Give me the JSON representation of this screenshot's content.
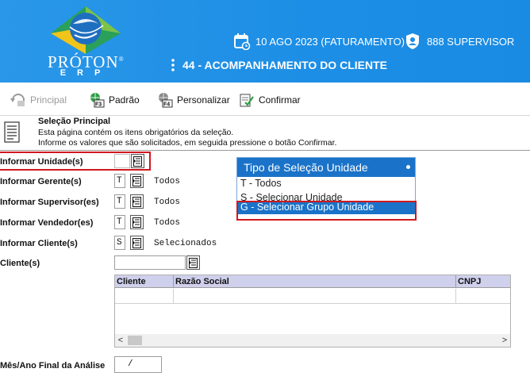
{
  "header": {
    "logo_name": "PRÓTON",
    "logo_sub": "ERP",
    "logo_mark": "®",
    "date_text": "10 AGO 2023 (FATURAMENTO)",
    "user_text": "888 SUPERVISOR",
    "screen_title": "44 - ACOMPANHAMENTO DO CLIENTE",
    "brand_color": "#1c8ee5"
  },
  "toolbar": {
    "principal_label": "Principal",
    "padrao_label": "Padrão",
    "padrao_key": "F3",
    "personalizar_label": "Personalizar",
    "personalizar_key": "F4",
    "confirmar_label": "Confirmar"
  },
  "description": {
    "title": "Seleção Principal",
    "line1": "Esta página contém os itens obrigatórios da seleção.",
    "line2": "Informe os valores que são solicitados, em seguida pressione o botão Confirmar."
  },
  "form": {
    "unidade_label": "Informar Unidade(s)",
    "unidade_value": "",
    "gerente_label": "Informar Gerente(s)",
    "gerente_value": "T",
    "gerente_desc": "Todos",
    "supervisor_label": "Informar Supervisor(es)",
    "supervisor_value": "T",
    "supervisor_desc": "Todos",
    "vendedor_label": "Informar Vendedor(es)",
    "vendedor_value": "T",
    "vendedor_desc": "Todos",
    "cliente_label": "Informar Cliente(s)",
    "cliente_value": "S",
    "cliente_desc": "Selecionados",
    "clientes_label": "Cliente(s)",
    "clientes_value": "",
    "mes_ano_label": "Mês/Ano Final da Análise",
    "mes_ano_value": "/"
  },
  "dropdown": {
    "title": "Tipo de Seleção Unidade",
    "options": [
      "T - Todos",
      "S - Selecionar Unidade",
      "G - Selecionar Grupo Unidade"
    ],
    "selected": "G - Selecionar Grupo Unidade",
    "accent_color": "#1a73c9"
  },
  "table": {
    "columns": [
      "Cliente",
      "Razão Social",
      "CNPJ"
    ],
    "rows": [
      [
        "",
        "",
        ""
      ]
    ],
    "scroll_left": "<",
    "scroll_right": ">"
  },
  "highlight_color": "#d0181f"
}
